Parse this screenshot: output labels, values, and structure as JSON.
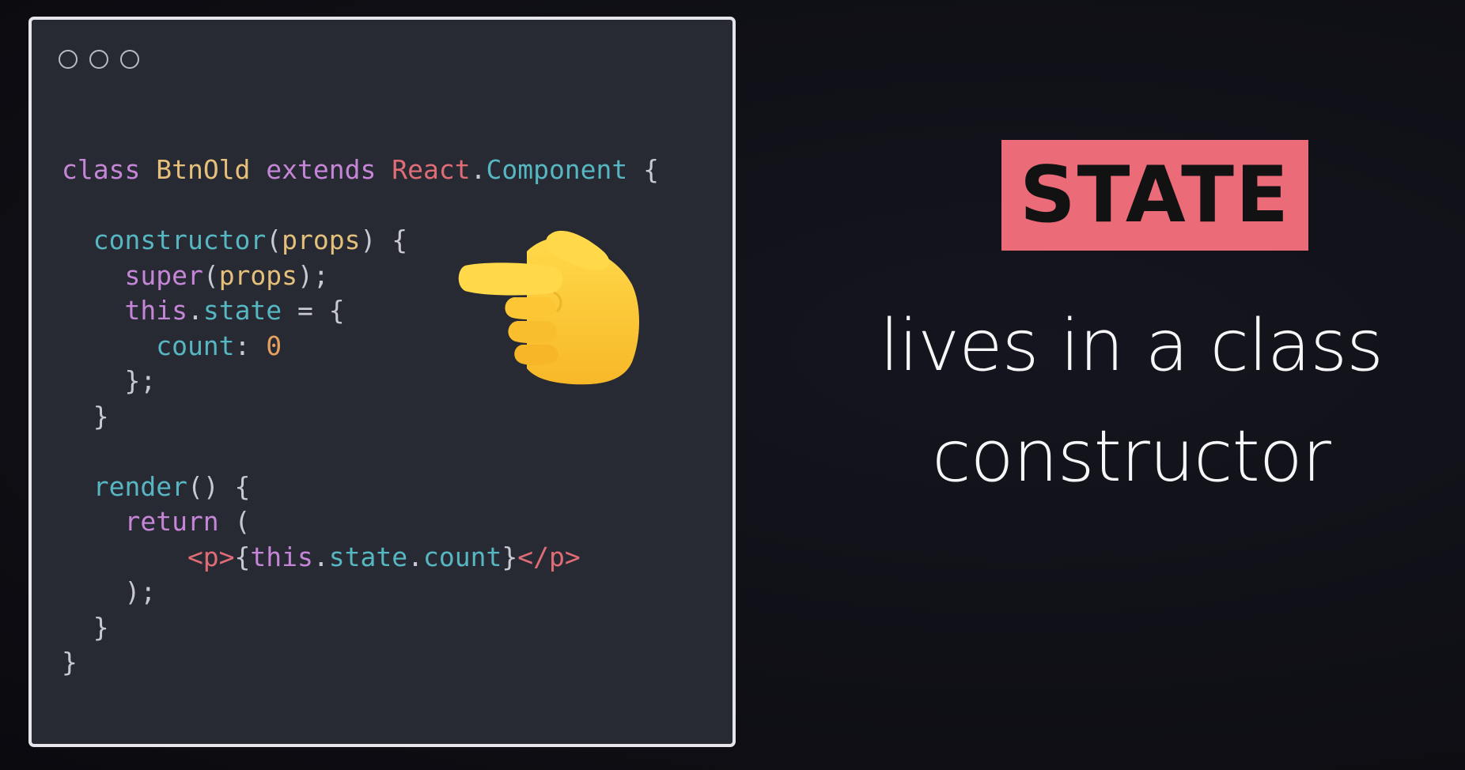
{
  "window": {
    "controls": [
      "window-dot",
      "window-dot",
      "window-dot"
    ]
  },
  "code": {
    "lines": [
      [
        {
          "t": "class ",
          "c": "kw"
        },
        {
          "t": "BtnOld ",
          "c": "cls"
        },
        {
          "t": "extends ",
          "c": "kw"
        },
        {
          "t": "React",
          "c": "react"
        },
        {
          "t": ".",
          "c": "pun"
        },
        {
          "t": "Component ",
          "c": "fn"
        },
        {
          "t": "{",
          "c": "pun"
        }
      ],
      [],
      [
        {
          "t": "  constructor",
          "c": "fn"
        },
        {
          "t": "(",
          "c": "pun"
        },
        {
          "t": "props",
          "c": "prm"
        },
        {
          "t": ") {",
          "c": "pun"
        }
      ],
      [
        {
          "t": "    super",
          "c": "kw"
        },
        {
          "t": "(",
          "c": "pun"
        },
        {
          "t": "props",
          "c": "prm"
        },
        {
          "t": ");",
          "c": "pun"
        }
      ],
      [
        {
          "t": "    this",
          "c": "kw"
        },
        {
          "t": ".",
          "c": "pun"
        },
        {
          "t": "state ",
          "c": "fn"
        },
        {
          "t": "= {",
          "c": "pun"
        }
      ],
      [
        {
          "t": "      count",
          "c": "fn"
        },
        {
          "t": ": ",
          "c": "pun"
        },
        {
          "t": "0",
          "c": "num"
        }
      ],
      [
        {
          "t": "    };",
          "c": "pun"
        }
      ],
      [
        {
          "t": "  }",
          "c": "pun"
        }
      ],
      [],
      [
        {
          "t": "  render",
          "c": "fn"
        },
        {
          "t": "() {",
          "c": "pun"
        }
      ],
      [
        {
          "t": "    return ",
          "c": "kw"
        },
        {
          "t": "(",
          "c": "pun"
        }
      ],
      [
        {
          "t": "        <p>",
          "c": "tag"
        },
        {
          "t": "{",
          "c": "pun"
        },
        {
          "t": "this",
          "c": "kw"
        },
        {
          "t": ".",
          "c": "pun"
        },
        {
          "t": "state",
          "c": "fn"
        },
        {
          "t": ".",
          "c": "pun"
        },
        {
          "t": "count",
          "c": "fn"
        },
        {
          "t": "}",
          "c": "pun"
        },
        {
          "t": "</p>",
          "c": "tag"
        }
      ],
      [
        {
          "t": "    );",
          "c": "pun"
        }
      ],
      [
        {
          "t": "  }",
          "c": "pun"
        }
      ],
      [
        {
          "t": "}",
          "c": "pun"
        }
      ]
    ]
  },
  "pointer_icon": "pointing-hand-icon",
  "badge": {
    "label": "STATE",
    "color": "#ec6b78"
  },
  "caption": {
    "line1": "lives in a class",
    "line2": "constructor"
  }
}
